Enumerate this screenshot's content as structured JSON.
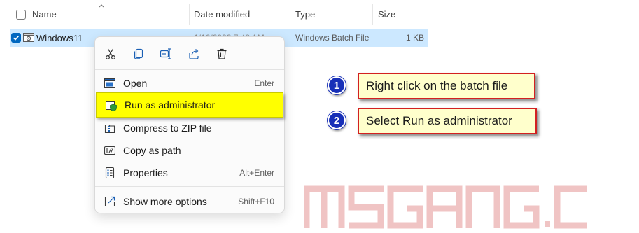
{
  "header": {
    "name": "Name",
    "date_modified": "Date modified",
    "type": "Type",
    "size": "Size"
  },
  "file_row": {
    "name": "Windows11",
    "date_modified": "1/16/2023 7:48 AM",
    "type": "Windows Batch File",
    "size": "1 KB",
    "selected": true
  },
  "context_menu": {
    "toolbar": [
      {
        "icon": "cut-icon"
      },
      {
        "icon": "copy-icon"
      },
      {
        "icon": "rename-icon"
      },
      {
        "icon": "share-icon"
      },
      {
        "icon": "delete-icon"
      }
    ],
    "items": [
      {
        "label": "Open",
        "shortcut": "Enter",
        "icon": "open-icon"
      },
      {
        "label": "Run as administrator",
        "shortcut": "",
        "icon": "shield-icon",
        "highlighted": true
      },
      {
        "label": "Compress to ZIP file",
        "shortcut": "",
        "icon": "zip-icon"
      },
      {
        "label": "Copy as path",
        "shortcut": "",
        "icon": "copy-path-icon"
      },
      {
        "label": "Properties",
        "shortcut": "Alt+Enter",
        "icon": "properties-icon"
      },
      {
        "label": "Show more options",
        "shortcut": "Shift+F10",
        "icon": "more-options-icon"
      }
    ]
  },
  "callouts": [
    {
      "number": "1",
      "text": "Right click on the batch file"
    },
    {
      "number": "2",
      "text": "Select Run as administrator"
    }
  ],
  "watermark": {
    "text": "MSGANG.COM"
  },
  "colors": {
    "selection": "#cce8ff",
    "checkbox_accent": "#0067c0",
    "highlight": "#ffff00",
    "callout_fill": "#ffffcc",
    "callout_border": "#d32020",
    "badge": "#1830b8",
    "watermark": "#f2c6c6"
  }
}
